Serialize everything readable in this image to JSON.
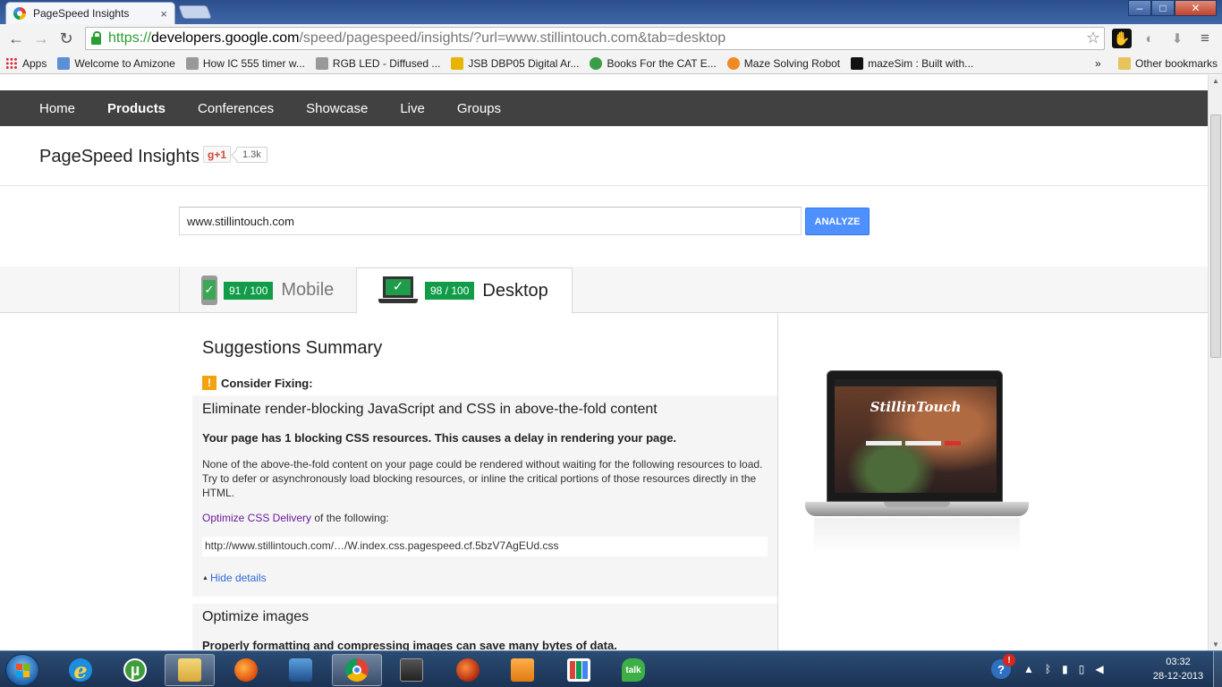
{
  "browser": {
    "tab_title": "PageSpeed Insights",
    "tab_close": "×",
    "window_controls": {
      "minimize": "–",
      "maximize": "□",
      "close": "✕"
    },
    "nav": {
      "back": "←",
      "forward": "→",
      "reload": "↻"
    },
    "url": {
      "scheme": "https://",
      "host": "developers.google.com",
      "path": "/speed/pagespeed/insights/?url=www.stillintouch.com&tab=desktop"
    },
    "star": "☆",
    "menu": "≡",
    "bookmarks": [
      {
        "label": "Apps",
        "icon": "apps-grid-icon"
      },
      {
        "label": "Welcome to Amizone",
        "icon": "amizone-icon"
      },
      {
        "label": "How IC 555 timer w...",
        "icon": "page-icon"
      },
      {
        "label": "RGB LED - Diffused ...",
        "icon": "sparkfun-icon"
      },
      {
        "label": "JSB DBP05 Digital Ar...",
        "icon": "flipkart-icon"
      },
      {
        "label": "Books For the CAT E...",
        "icon": "books-icon"
      },
      {
        "label": "Maze Solving Robot",
        "icon": "instructables-icon"
      },
      {
        "label": "mazeSim : Built with...",
        "icon": "processing-icon"
      }
    ],
    "bookmarks_more": "»",
    "other_bookmarks": "Other bookmarks"
  },
  "site": {
    "nav": [
      "Home",
      "Products",
      "Conferences",
      "Showcase",
      "Live",
      "Groups"
    ],
    "active_nav": "Products",
    "title": "PageSpeed Insights",
    "gplus_label": "g+1",
    "gplus_count": "1.3k",
    "input_value": "www.stillintouch.com",
    "analyze_label": "ANALYZE",
    "tabs": {
      "mobile": {
        "score": "91 / 100",
        "label": "Mobile"
      },
      "desktop": {
        "score": "98 / 100",
        "label": "Desktop"
      }
    },
    "score_color": "#129c49"
  },
  "results": {
    "summary_title": "Suggestions Summary",
    "consider_fixing": "Consider Fixing:",
    "warn_glyph": "!",
    "rule1": {
      "title": "Eliminate render-blocking JavaScript and CSS in above-the-fold content",
      "lead": "Your page has 1 blocking CSS resources. This causes a delay in rendering your page.",
      "desc": "None of the above-the-fold content on your page could be rendered without waiting for the following resources to load. Try to defer or asynchronously load blocking resources, or inline the critical portions of those resources directly in the HTML.",
      "link_text": "Optimize CSS Delivery",
      "link_suffix": " of the following:",
      "resource": "http://www.stillintouch.com/…/W.index.css.pagespeed.cf.5bzV7AgEUd.css",
      "hide_details": "Hide details"
    },
    "rule2": {
      "title": "Optimize images",
      "lead": "Properly formatting and compressing images can save many bytes of data."
    }
  },
  "preview": {
    "logo_text": "StillinTouch"
  },
  "taskbar": {
    "talk_label": "talk",
    "tray_help": "?",
    "tray_alert": "!",
    "time": "03:32",
    "date": "28-12-2013"
  }
}
